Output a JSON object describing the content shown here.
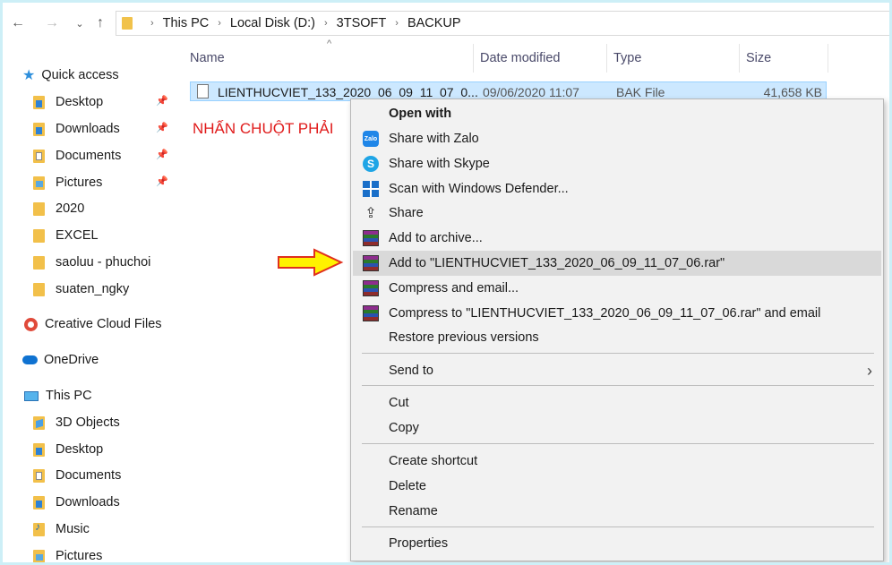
{
  "address_bar": {
    "crumbs": [
      "This PC",
      "Local Disk (D:)",
      "3TSOFT",
      "BACKUP"
    ]
  },
  "nav": {
    "quick_access": "Quick access",
    "quick_items": [
      "Desktop",
      "Downloads",
      "Documents",
      "Pictures",
      "2020",
      "EXCEL",
      "saoluu - phuchoi",
      "suaten_ngky"
    ],
    "creative_cloud": "Creative Cloud Files",
    "onedrive": "OneDrive",
    "this_pc": "This PC",
    "pc_items": [
      "3D Objects",
      "Desktop",
      "Documents",
      "Downloads",
      "Music",
      "Pictures"
    ]
  },
  "columns": {
    "name": "Name",
    "date": "Date modified",
    "type": "Type",
    "size": "Size"
  },
  "file": {
    "name": "LIENTHUCVIET_133_2020_06_09_11_07_0...",
    "date": "09/06/2020 11:07",
    "type": "BAK File",
    "size": "41,658 KB"
  },
  "annotation": "NHẤN CHUỘT PHẢI",
  "menu": {
    "open_with": "Open with",
    "share_zalo": "Share with Zalo",
    "share_skype": "Share with Skype",
    "scan_defender": "Scan with Windows Defender...",
    "share": "Share",
    "add_archive": "Add to archive...",
    "add_to_rar": "Add to \"LIENTHUCVIET_133_2020_06_09_11_07_06.rar\"",
    "compress_email": "Compress and email...",
    "compress_to_rar_email": "Compress to \"LIENTHUCVIET_133_2020_06_09_11_07_06.rar\" and email",
    "restore_versions": "Restore previous versions",
    "send_to": "Send to",
    "cut": "Cut",
    "copy": "Copy",
    "create_shortcut": "Create shortcut",
    "delete": "Delete",
    "rename": "Rename",
    "properties": "Properties",
    "zalo_icon_text": "Zalo",
    "skype_icon_text": "S"
  },
  "colors": {
    "annotation": "#e01b1b",
    "selection": "#cce8ff",
    "arrow_fill": "#fff200",
    "arrow_stroke": "#e0301e"
  }
}
